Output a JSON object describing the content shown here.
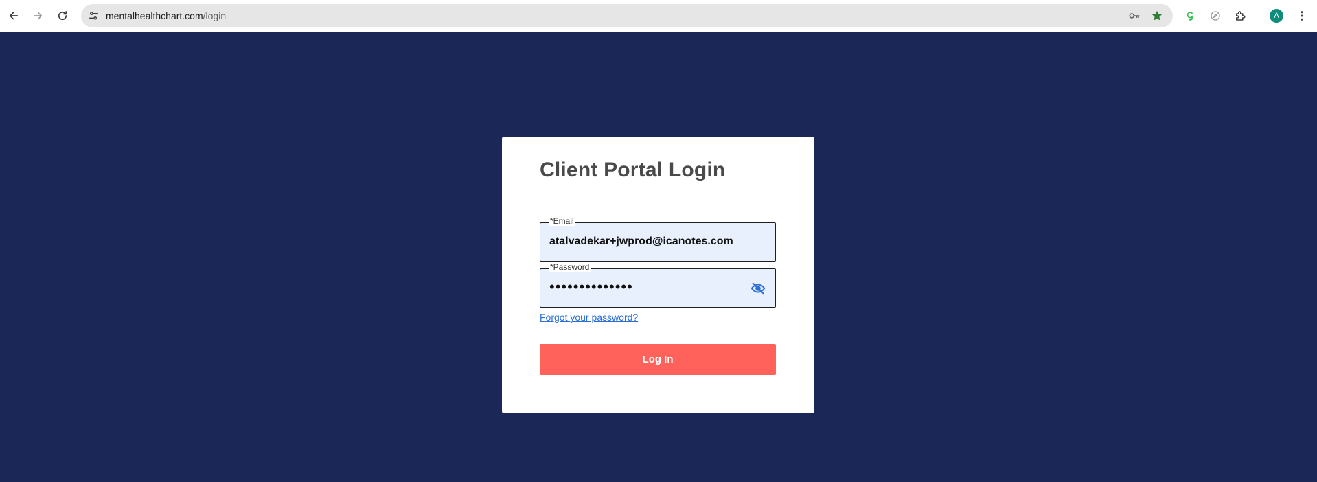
{
  "browser": {
    "url_domain": "mentalhealthchart.com",
    "url_path": "/login",
    "avatar_letter": "A"
  },
  "login": {
    "title": "Client Portal Login",
    "email_label": "*Email",
    "email_value": "atalvadekar+jwprod@icanotes.com",
    "password_label": "*Password",
    "password_masked": "••••••••••••••",
    "forgot_link": "Forgot your password?",
    "submit_label": "Log In"
  },
  "colors": {
    "page_background": "#1b2756",
    "button": "#ff625a",
    "link": "#2b6fd6",
    "field_fill": "#e8f0fe"
  },
  "icons": {
    "back": "arrow-left-icon",
    "forward": "arrow-right-icon",
    "reload": "reload-icon",
    "site_info": "tune-icon",
    "password_manager": "key-icon",
    "bookmark": "star-icon",
    "extension_1": "grammarly-icon",
    "extension_2": "compass-icon",
    "extensions": "puzzle-icon",
    "menu": "kebab-menu-icon",
    "password_toggle": "eye-off-icon"
  }
}
